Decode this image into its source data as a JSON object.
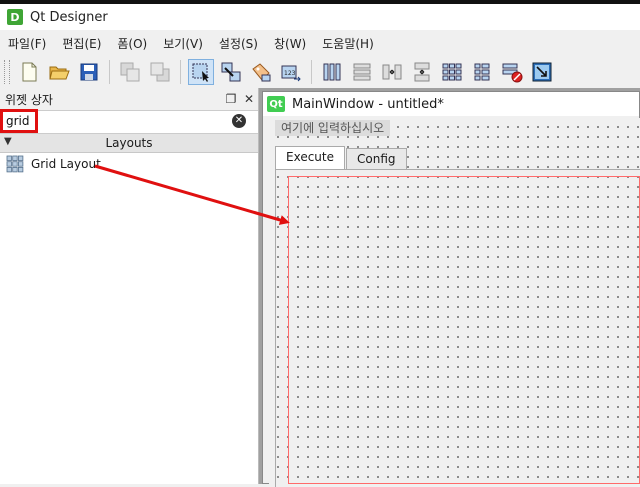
{
  "window": {
    "title": "Qt Designer",
    "app_icon_letter": "D"
  },
  "menubar": {
    "items": [
      "파일(F)",
      "편집(E)",
      "폼(O)",
      "보기(V)",
      "설정(S)",
      "창(W)",
      "도움말(H)"
    ]
  },
  "toolbar": {
    "icons": [
      "new-file-icon",
      "open-folder-icon",
      "save-icon",
      "send-to-back-icon",
      "bring-to-front-icon",
      "edit-widgets-icon",
      "edit-signals-slots-icon",
      "edit-buddies-icon",
      "edit-tab-order-icon",
      "layout-horizontal-icon",
      "layout-vertical-icon",
      "layout-h-splitter-icon",
      "layout-v-splitter-icon",
      "layout-grid-icon",
      "layout-form-icon",
      "break-layout-icon",
      "adjust-size-icon"
    ]
  },
  "widget_box": {
    "title": "위젯 상자",
    "search": {
      "value": "grid"
    },
    "category": "Layouts",
    "items": [
      {
        "label": "Grid Layout",
        "icon": "grid-layout-icon"
      }
    ]
  },
  "main_window": {
    "title": "MainWindow - untitled*",
    "icon_text": "Qt",
    "menu_placeholder": "여기에 입력하십시오",
    "tabs": [
      {
        "label": "Execute",
        "selected": true
      },
      {
        "label": "Config",
        "selected": false
      }
    ]
  },
  "colors": {
    "highlight_box": "#e01010",
    "arrow": "#e01010",
    "layout_border": "#ff6a6a"
  }
}
